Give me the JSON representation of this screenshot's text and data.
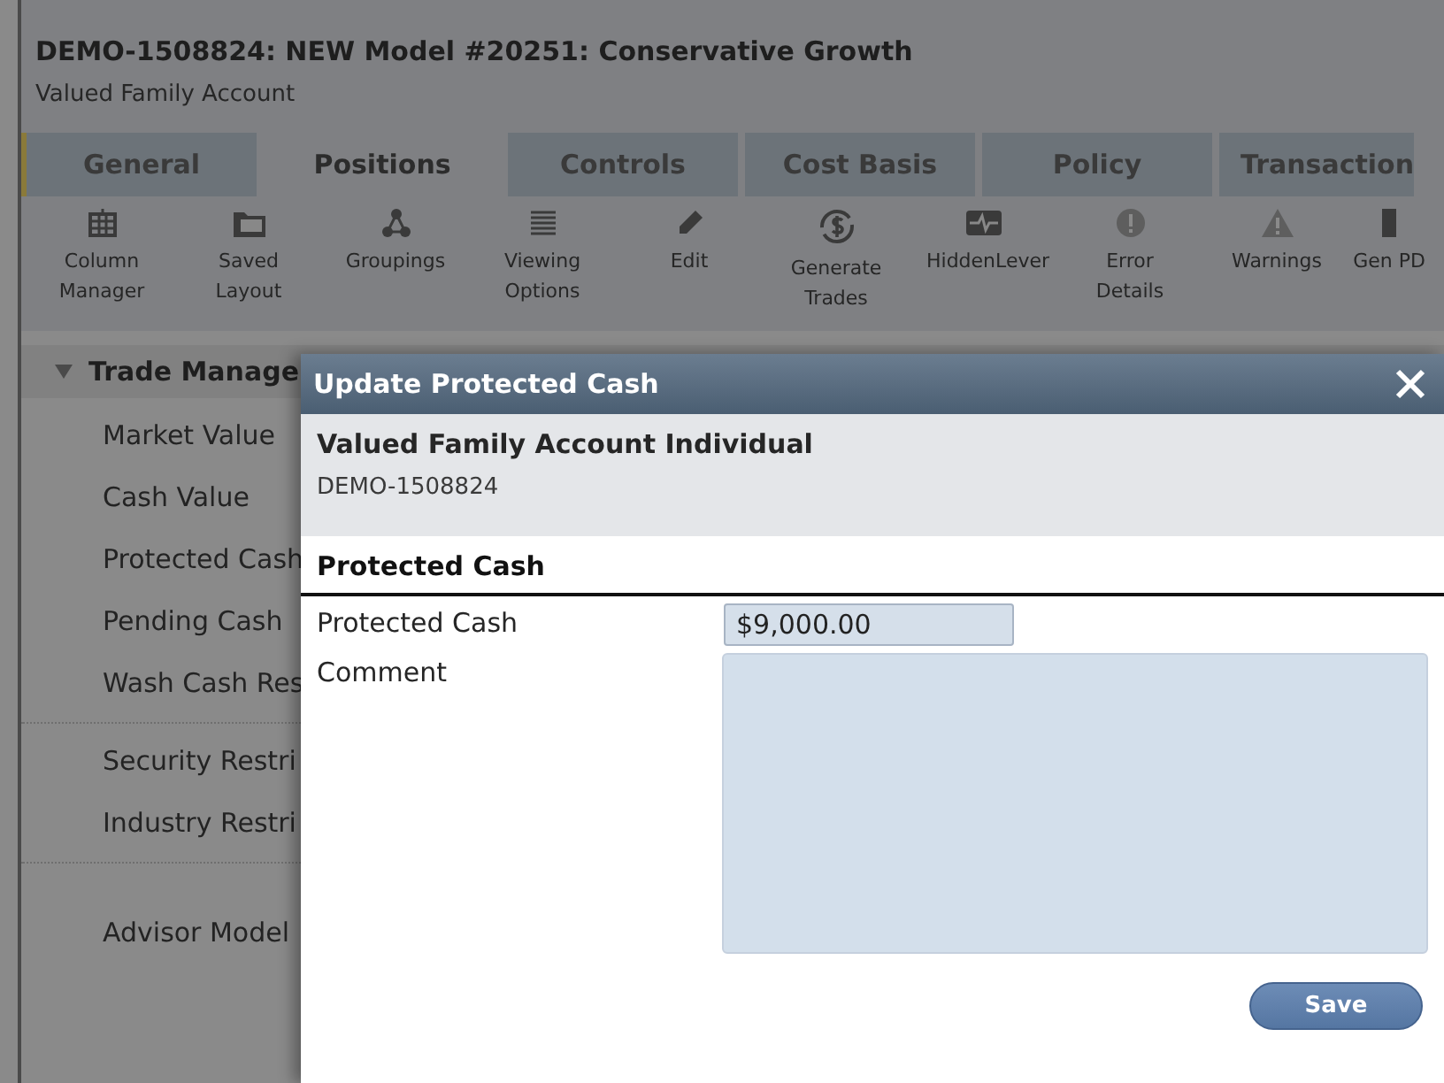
{
  "header": {
    "title": "DEMO-1508824: NEW Model #20251: Conservative Growth",
    "subtitle": "Valued Family Account"
  },
  "tabs": [
    {
      "label": "General",
      "selected": false
    },
    {
      "label": "Positions",
      "selected": true
    },
    {
      "label": "Controls",
      "selected": false
    },
    {
      "label": "Cost Basis",
      "selected": false
    },
    {
      "label": "Policy",
      "selected": false
    },
    {
      "label": "Transaction",
      "selected": false
    }
  ],
  "toolbar": [
    {
      "label": "Column Manager",
      "kind": "grid"
    },
    {
      "label": "Saved Layout",
      "kind": "folder"
    },
    {
      "label": "Groupings",
      "kind": "nodes"
    },
    {
      "label": "Viewing Options",
      "kind": "lines"
    },
    {
      "label": "Edit",
      "kind": "pencil"
    },
    {
      "label": "Generate Trades",
      "kind": "dollar"
    },
    {
      "label": "HiddenLever",
      "kind": "pulse"
    },
    {
      "label": "Error Details",
      "kind": "error"
    },
    {
      "label": "Warnings",
      "kind": "warning"
    },
    {
      "label": "Gen PD",
      "kind": "doc"
    }
  ],
  "sidebar": {
    "label": "Trade Manage",
    "expanded": true,
    "sections": [
      {
        "items": [
          "Market Value",
          "Cash Value",
          "Protected Cash",
          "Pending Cash",
          "Wash Cash Res"
        ]
      },
      {
        "items": [
          "Security Restri",
          "Industry Restri"
        ]
      },
      {
        "items": [
          "Advisor Model"
        ]
      }
    ]
  },
  "dialog": {
    "title": "Update Protected Cash",
    "account_name": "Valued Family Account Individual",
    "account_id": "DEMO-1508824",
    "section": "Protected Cash",
    "fields": [
      {
        "label": "Protected Cash",
        "kind": "input",
        "value": "$9,000.00"
      },
      {
        "label": "Comment",
        "kind": "textarea"
      }
    ],
    "save": "Save"
  }
}
